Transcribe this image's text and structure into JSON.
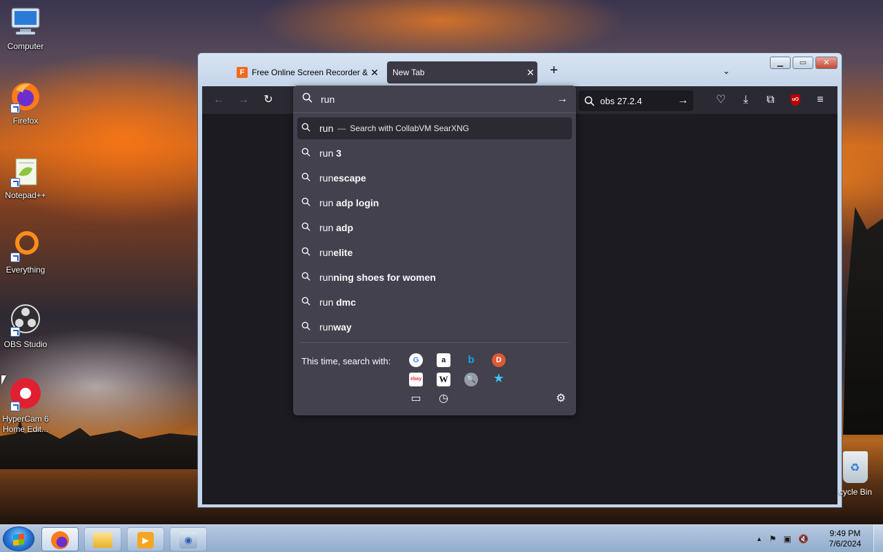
{
  "desktop": {
    "icons": [
      {
        "label": "Computer"
      },
      {
        "label": "Firefox"
      },
      {
        "label": "Notepad++"
      },
      {
        "label": "Everything"
      },
      {
        "label": "OBS Studio"
      },
      {
        "label": "HyperCam 6 Home Edit..."
      }
    ],
    "recycle_bin": {
      "label": "cycle Bin"
    }
  },
  "browser": {
    "tabs": [
      {
        "title": "Free Online Screen Recorder &",
        "close": "✕",
        "favicon": "F"
      },
      {
        "title": "New Tab",
        "close": "✕"
      }
    ],
    "new_tab": "+",
    "list_all_tabs": "⌄",
    "window_controls": {
      "minimize": "▁",
      "maximize": "▭",
      "close": "✕"
    },
    "toolbar": {
      "back": "←",
      "forward": "→",
      "reload": "↻",
      "search_value": "obs 27.2.4",
      "search_go": "→",
      "pocket": "♡",
      "downloads": "⤓",
      "extensions": "⧉",
      "ublock_text": "uO",
      "menu": "≡"
    },
    "urlbar": {
      "value": "run",
      "go": "→",
      "results": [
        {
          "typed": "run",
          "rest": "",
          "separator": "—",
          "action": "Search with CollabVM SearXNG",
          "selected": true
        },
        {
          "typed": "run ",
          "rest": "3"
        },
        {
          "typed": "run",
          "rest": "escape"
        },
        {
          "typed": "run ",
          "rest": "adp login"
        },
        {
          "typed": "run ",
          "rest": "adp"
        },
        {
          "typed": "run",
          "rest": "elite"
        },
        {
          "typed": "run",
          "rest": "ning shoes for women"
        },
        {
          "typed": "run ",
          "rest": "dmc"
        },
        {
          "typed": "run",
          "rest": "way"
        }
      ],
      "oneoff_label": "This time, search with:",
      "engines": {
        "google": "G",
        "amazon": "a",
        "bing": "b",
        "duckduckgo": "D",
        "ebay": "ebay",
        "wikipedia": "W",
        "searxng": "🔍",
        "bookmarks": "★",
        "tabs": "▭",
        "history": "◷"
      },
      "settings": "⚙"
    }
  },
  "taskbar": {
    "tray": {
      "show_hidden": "▲",
      "flag": "⚑",
      "network": "▣",
      "volume": "🔇"
    },
    "clock": {
      "time": "9:49 PM",
      "date": "7/6/2024"
    }
  },
  "colors": {
    "toolbar_bg": "#2b2a33",
    "content_bg": "#1c1b22",
    "panel_bg": "#42414d",
    "text": "#fbfbfe"
  }
}
